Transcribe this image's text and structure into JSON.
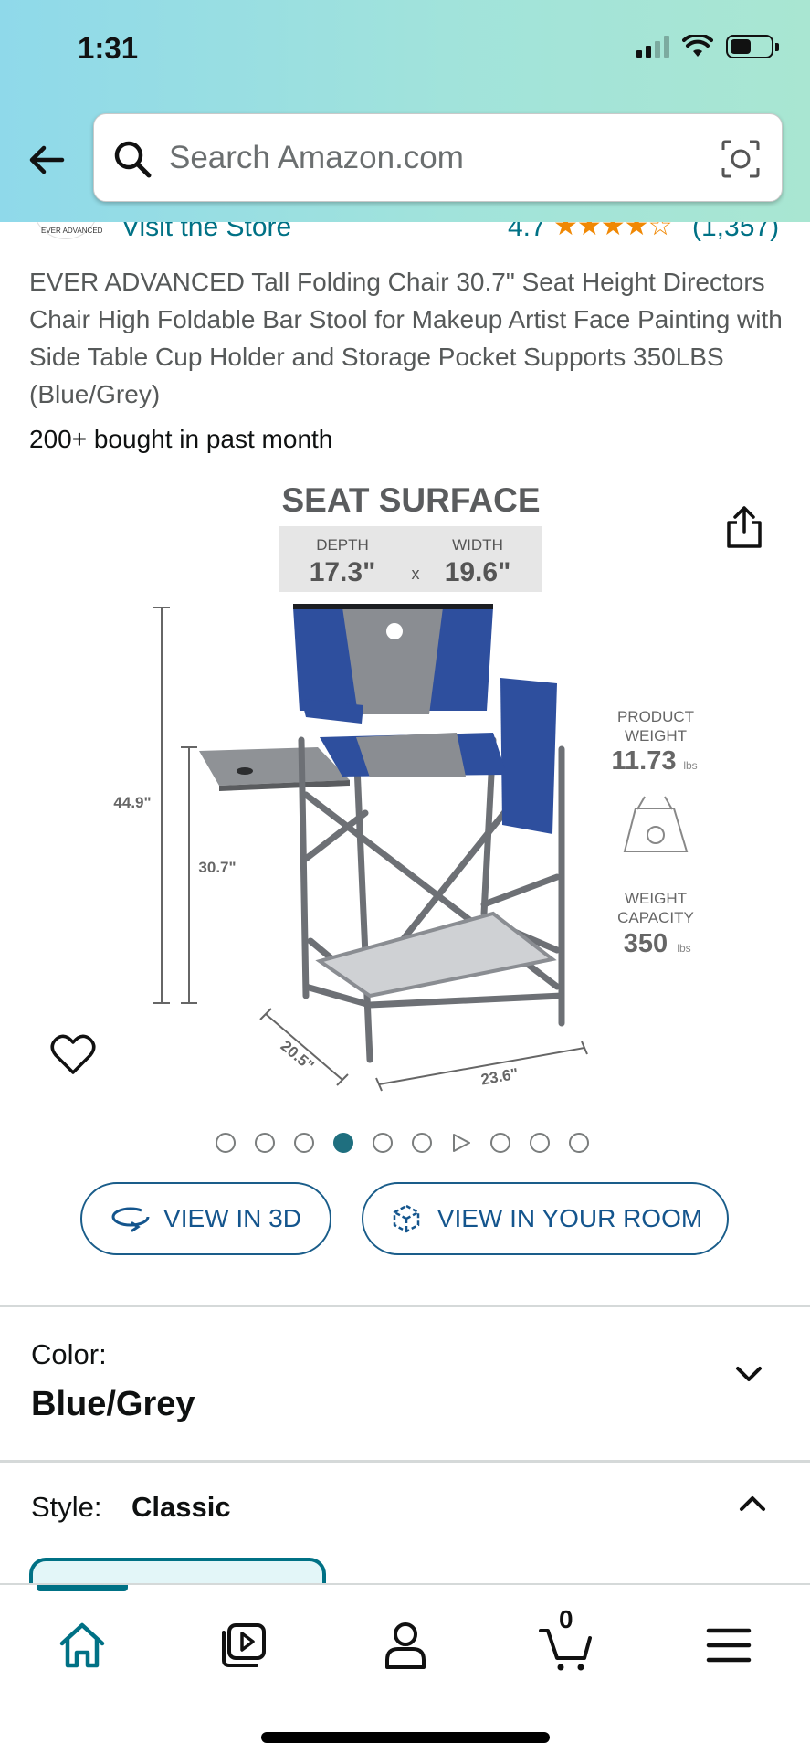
{
  "status_bar": {
    "time": "1:31"
  },
  "search": {
    "placeholder": "Search Amazon.com"
  },
  "store": {
    "logo_text": "EVER ADVANCED",
    "visit_label": "Visit the Store",
    "rating": "4.7",
    "stars": "★★★★☆",
    "rating_count": "(1,357)"
  },
  "product": {
    "title": "EVER ADVANCED Tall Folding Chair 30.7\" Seat Height Directors Chair High Foldable Bar Stool for Makeup Artist Face Painting with Side Table Cup Holder and Storage Pocket Supports 350LBS (Blue/Grey)",
    "bought": "200+ bought in past month"
  },
  "image_text": {
    "seat_surface": "SEAT SURFACE",
    "depth_label": "DEPTH",
    "depth_value": "17.3\"",
    "x": "x",
    "width_label": "WIDTH",
    "width_value": "19.6\"",
    "height_total": "44.9\"",
    "seat_height": "30.7\"",
    "base_depth": "20.5\"",
    "base_width": "23.6\"",
    "product_weight_l1": "PRODUCT",
    "product_weight_l2": "WEIGHT",
    "product_weight_value": "11.73",
    "product_weight_unit": "lbs",
    "capacity_l1": "WEIGHT",
    "capacity_l2": "CAPACITY",
    "capacity_value": "350",
    "capacity_unit": "lbs"
  },
  "carousel": {
    "total": 10,
    "active_index": 3,
    "video_index": 6
  },
  "buttons": {
    "view_3d": "VIEW IN 3D",
    "view_room": "VIEW IN YOUR ROOM"
  },
  "color": {
    "label": "Color:",
    "value": "Blue/Grey"
  },
  "style": {
    "label": "Style:",
    "value": "Classic"
  },
  "bottom_nav": {
    "cart_count": "0"
  },
  "colors": {
    "accent": "#007185",
    "star": "#f08804",
    "button_text": "#14558d",
    "chair_blue": "#2e4f9e",
    "chair_grey": "#8a8d92"
  }
}
